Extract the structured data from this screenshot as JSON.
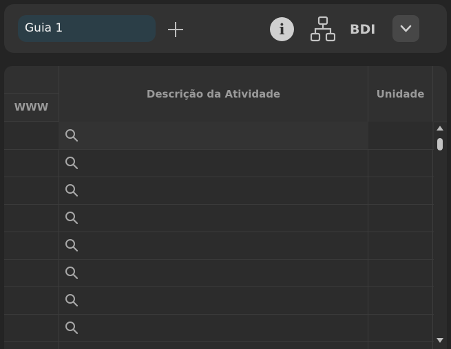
{
  "toolbar": {
    "tab_label": "Guia 1",
    "add_icon": "plus-icon",
    "info_icon": "info-icon",
    "info_glyph": "i",
    "hierarchy_icon": "sitemap-icon",
    "bdi_label": "BDI",
    "collapse_icon": "chevron-down-icon"
  },
  "table": {
    "columns": [
      "WWW",
      "Descrição da Atividade",
      "Unidade"
    ],
    "row_icon": "search-icon",
    "visible_rows": 8
  },
  "colors": {
    "background": "#242424",
    "toolbar": "#323232",
    "active_tab": "#2b3e47",
    "grid": "#2c2c2c",
    "header_text": "#9a9a9a"
  }
}
